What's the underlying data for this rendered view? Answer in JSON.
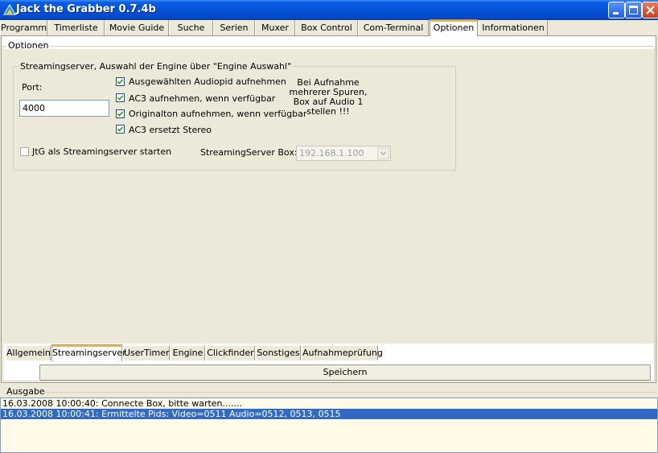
{
  "window": {
    "title": "Jack the Grabber 0.7.4b"
  },
  "top_tabs": [
    "Programm",
    "Timerliste",
    "Movie Guide",
    "Suche",
    "Serien",
    "Muxer",
    "Box Control",
    "Com-Terminal",
    "Optionen",
    "Informationen"
  ],
  "top_tabs_active": "Optionen",
  "options_group_label": "Optionen",
  "streaming": {
    "group_label": "Streamingserver, Auswahl der Engine über \"Engine Auswahl\"",
    "port_label": "Port:",
    "port_value": "4000",
    "checkboxes": [
      {
        "label": "Ausgewählten Audiopid aufnehmen",
        "checked": true
      },
      {
        "label": "AC3 aufnehmen, wenn verfügbar",
        "checked": true
      },
      {
        "label": "Originalton aufnehmen, wenn verfügbar",
        "checked": true
      },
      {
        "label": "AC3 ersetzt Stereo",
        "checked": true
      }
    ],
    "info_lines": [
      "Bei Aufnahme",
      "mehrerer Spuren,",
      "Box auf Audio 1",
      "stellen !!!"
    ],
    "start_server_label": "JtG  als Streamingserver starten",
    "start_server_checked": false,
    "server_box_label": "StreamingServer Box:",
    "server_box_value": "192.168.1.100"
  },
  "bottom_tabs": [
    "Allgemein",
    "Streamingserver",
    "UserTimer",
    "Engine",
    "Clickfinder",
    "Sonstiges",
    "Aufnahmeprüfung"
  ],
  "bottom_tabs_active": "Streamingserver",
  "save_button": "Speichern",
  "output": {
    "label": "Ausgabe",
    "lines": [
      "16.03.2008 10:00:40: Connecte Box, bitte warten.......",
      "16.03.2008 10:00:41: Ermittelte Pids: Video=0511 Audio=0512, 0513, 0515"
    ],
    "selected_index": 1
  },
  "colors": {
    "titlebar": "#0552d8",
    "face": "#ece9d8",
    "selection": "#316ac5",
    "log_bg": "#fffbe8"
  }
}
